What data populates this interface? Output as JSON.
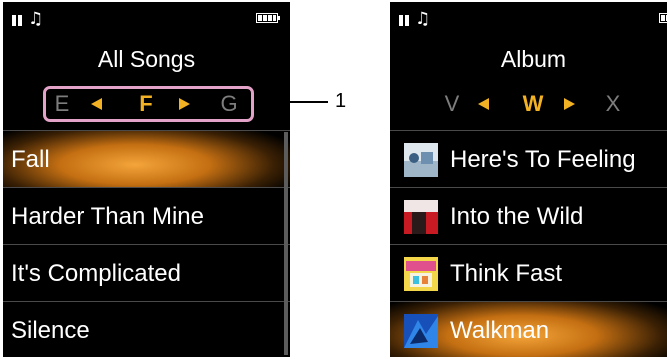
{
  "left_screen": {
    "title": "All Songs",
    "index": {
      "prev": "E",
      "current": "F",
      "next": "G"
    },
    "items": [
      {
        "label": "Fall",
        "selected": true
      },
      {
        "label": "Harder Than Mine",
        "selected": false
      },
      {
        "label": "It's Complicated",
        "selected": false
      },
      {
        "label": "Silence",
        "selected": false
      }
    ]
  },
  "right_screen": {
    "title": "Album",
    "index": {
      "prev": "V",
      "current": "W",
      "next": "X"
    },
    "items": [
      {
        "label": "Here's To Feeling",
        "icon": "album-art-icon",
        "selected": false
      },
      {
        "label": "Into the Wild",
        "icon": "album-art-icon",
        "selected": false
      },
      {
        "label": "Think Fast",
        "icon": "album-art-icon",
        "selected": false
      },
      {
        "label": "Walkman",
        "icon": "album-art-icon",
        "selected": true
      }
    ]
  },
  "callout": {
    "number": "1"
  },
  "colors": {
    "accent": "#f2b224",
    "index_box_border": "#e3a3c8",
    "dim_letter": "#7d7d7d",
    "screen_bg": "#000000",
    "selected_row": "#e08a1f"
  },
  "status_icons": [
    "pause-icon",
    "music-note-icon",
    "battery-icon"
  ]
}
